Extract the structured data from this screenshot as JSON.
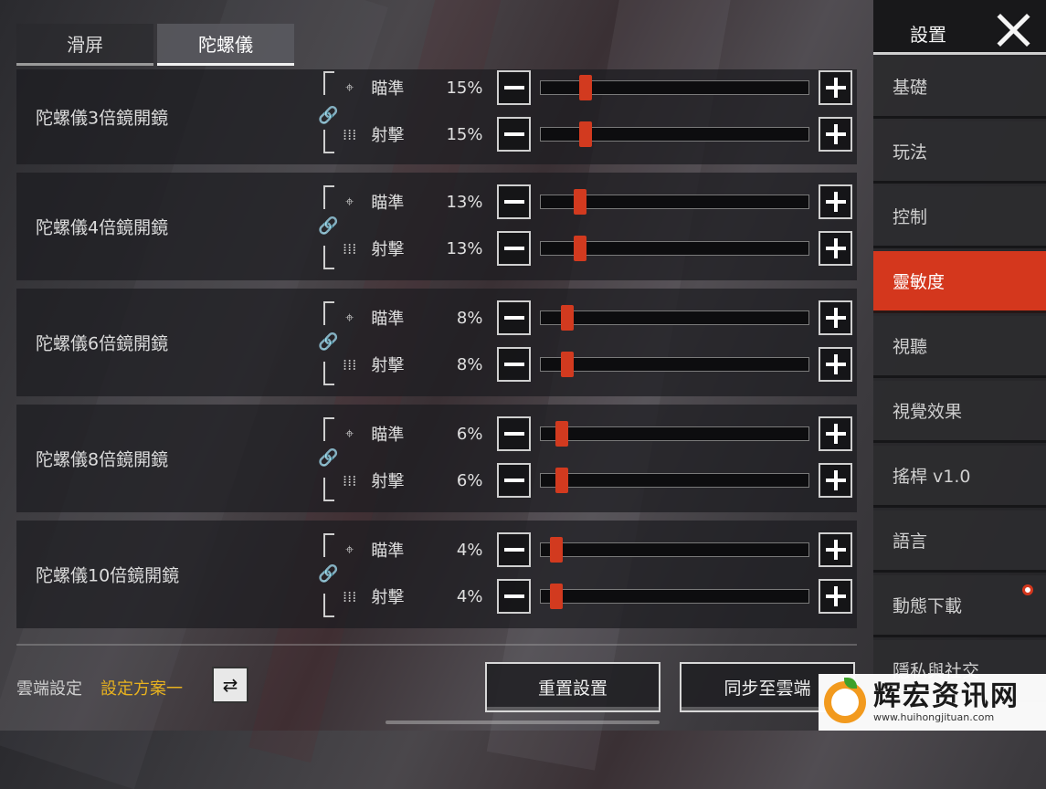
{
  "tabs": [
    {
      "label": "滑屏",
      "active": false
    },
    {
      "label": "陀螺儀",
      "active": true
    }
  ],
  "groups": [
    {
      "label": "陀螺儀3倍鏡開鏡",
      "aim": {
        "label": "瞄準",
        "value": "15%",
        "fraction": 0.15
      },
      "shoot": {
        "label": "射擊",
        "value": "15%",
        "fraction": 0.15
      }
    },
    {
      "label": "陀螺儀4倍鏡開鏡",
      "aim": {
        "label": "瞄準",
        "value": "13%",
        "fraction": 0.13
      },
      "shoot": {
        "label": "射擊",
        "value": "13%",
        "fraction": 0.13
      }
    },
    {
      "label": "陀螺儀6倍鏡開鏡",
      "aim": {
        "label": "瞄準",
        "value": "8%",
        "fraction": 0.08
      },
      "shoot": {
        "label": "射擊",
        "value": "8%",
        "fraction": 0.08
      }
    },
    {
      "label": "陀螺儀8倍鏡開鏡",
      "aim": {
        "label": "瞄準",
        "value": "6%",
        "fraction": 0.06
      },
      "shoot": {
        "label": "射擊",
        "value": "6%",
        "fraction": 0.06
      }
    },
    {
      "label": "陀螺儀10倍鏡開鏡",
      "aim": {
        "label": "瞄準",
        "value": "4%",
        "fraction": 0.04
      },
      "shoot": {
        "label": "射擊",
        "value": "4%",
        "fraction": 0.04
      }
    }
  ],
  "footer": {
    "cloud_label": "雲端設定",
    "cloud_plan": "設定方案一",
    "reset_label": "重置設置",
    "sync_label": "同步至雲端"
  },
  "side": {
    "title": "設置",
    "items": [
      {
        "label": "基礎"
      },
      {
        "label": "玩法"
      },
      {
        "label": "控制"
      },
      {
        "label": "靈敏度",
        "active": true
      },
      {
        "label": "視聽"
      },
      {
        "label": "視覺效果"
      },
      {
        "label": "搖桿 v1.0"
      },
      {
        "label": "語言"
      },
      {
        "label": "動態下載",
        "notification": true
      },
      {
        "label": "隱私與社交"
      }
    ]
  },
  "watermark": {
    "title": "辉宏资讯网",
    "url": "www.huihongjituan.com"
  },
  "colors": {
    "accent": "#d4371d",
    "plan_highlight": "#e8b21f"
  },
  "icons": {
    "aim": "crosshair-icon",
    "shoot": "bullets-icon",
    "link": "chain-link-icon",
    "swap": "swap-arrows-icon",
    "close": "close-x-icon"
  }
}
